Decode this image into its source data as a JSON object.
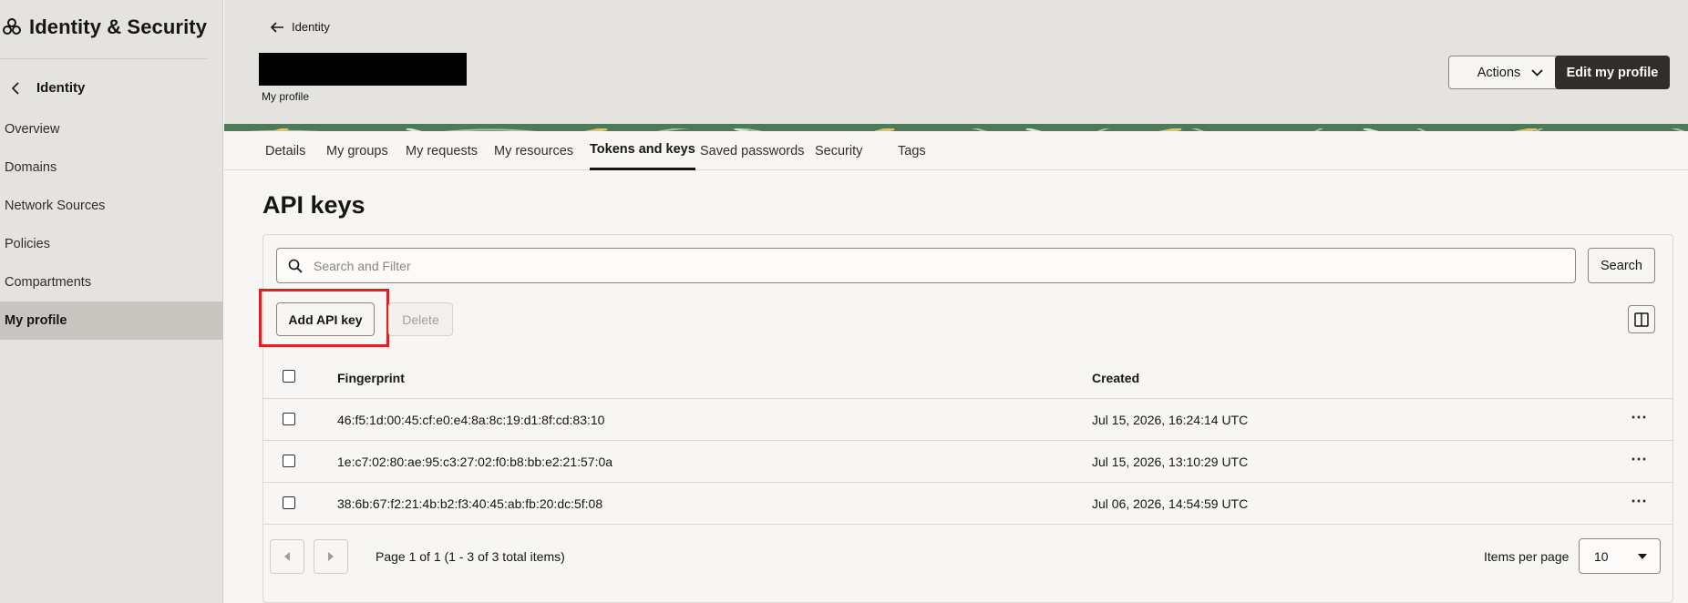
{
  "sidebar": {
    "app_title": "Identity & Security",
    "back_label": "Identity",
    "items": [
      {
        "label": "Overview"
      },
      {
        "label": "Domains"
      },
      {
        "label": "Network Sources"
      },
      {
        "label": "Policies"
      },
      {
        "label": "Compartments"
      },
      {
        "label": "My profile",
        "active": true
      }
    ]
  },
  "header": {
    "breadcrumb": "Identity",
    "subtitle": "My profile",
    "actions_label": "Actions",
    "edit_label": "Edit my profile"
  },
  "tabs": [
    {
      "label": "Details"
    },
    {
      "label": "My groups"
    },
    {
      "label": "My requests"
    },
    {
      "label": "My resources"
    },
    {
      "label": "Tokens and keys",
      "active": true
    },
    {
      "label": "Saved passwords"
    },
    {
      "label": "Security"
    },
    {
      "label": "Tags"
    }
  ],
  "main": {
    "title": "API keys",
    "search": {
      "placeholder": "Search and Filter",
      "value": "",
      "button": "Search"
    },
    "add_label": "Add API key",
    "delete_label": "Delete",
    "table": {
      "columns": [
        "Fingerprint",
        "Created"
      ],
      "rows": [
        {
          "fingerprint": "46:f5:1d:00:45:cf:e0:e4:8a:8c:19:d1:8f:cd:83:10",
          "created": "Jul 15, 2026, 16:24:14 UTC"
        },
        {
          "fingerprint": "1e:c7:02:80:ae:95:c3:27:02:f0:b8:bb:e2:21:57:0a",
          "created": "Jul 15, 2026, 13:10:29 UTC"
        },
        {
          "fingerprint": "38:6b:67:f2:21:4b:b2:f3:40:45:ab:fb:20:dc:5f:08",
          "created": "Jul 06, 2026, 14:54:59 UTC"
        }
      ]
    },
    "pager": {
      "text": "Page 1 of 1 (1 - 3 of 3 total items)",
      "items_per_page_label": "Items per page",
      "items_per_page_value": "10"
    }
  },
  "colors": {
    "accent_dark": "#312d2a",
    "highlight": "#e02020",
    "banner": "#4e7a5b"
  }
}
